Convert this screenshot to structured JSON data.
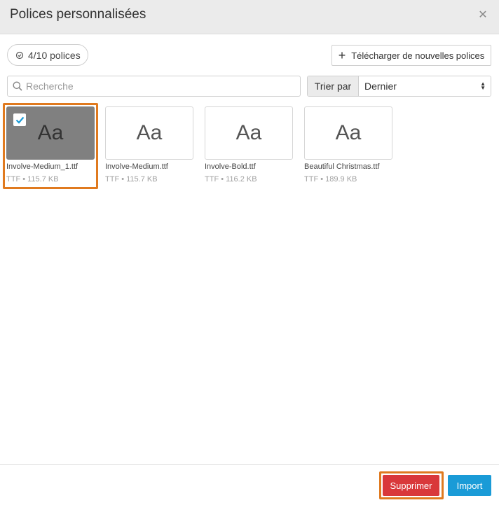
{
  "dialog": {
    "title": "Polices personnalisées",
    "close_icon": "close-icon"
  },
  "toolbar": {
    "count_label": "4/10 polices",
    "upload_label": "Télécharger de nouvelles polices"
  },
  "search": {
    "placeholder": "Recherche",
    "value": ""
  },
  "sort": {
    "label": "Trier par",
    "selected": "Dernier"
  },
  "fonts": [
    {
      "preview": "Aa",
      "name": "Involve-Medium_1.ttf",
      "meta": "TTF • 115.7 KB",
      "selected": true
    },
    {
      "preview": "Aa",
      "name": "Involve-Medium.ttf",
      "meta": "TTF • 115.7 KB",
      "selected": false
    },
    {
      "preview": "Aa",
      "name": "Involve-Bold.ttf",
      "meta": "TTF • 116.2 KB",
      "selected": false
    },
    {
      "preview": "Aa",
      "name": "Beautiful Christmas.ttf",
      "meta": "TTF • 189.9 KB",
      "selected": false
    }
  ],
  "footer": {
    "delete_label": "Supprimer",
    "import_label": "Import"
  },
  "colors": {
    "highlight": "#e07a1f",
    "delete": "#d9383a",
    "import": "#1a9bd7",
    "selected_preview": "#808080",
    "checkmark": "#1a9bd7"
  }
}
